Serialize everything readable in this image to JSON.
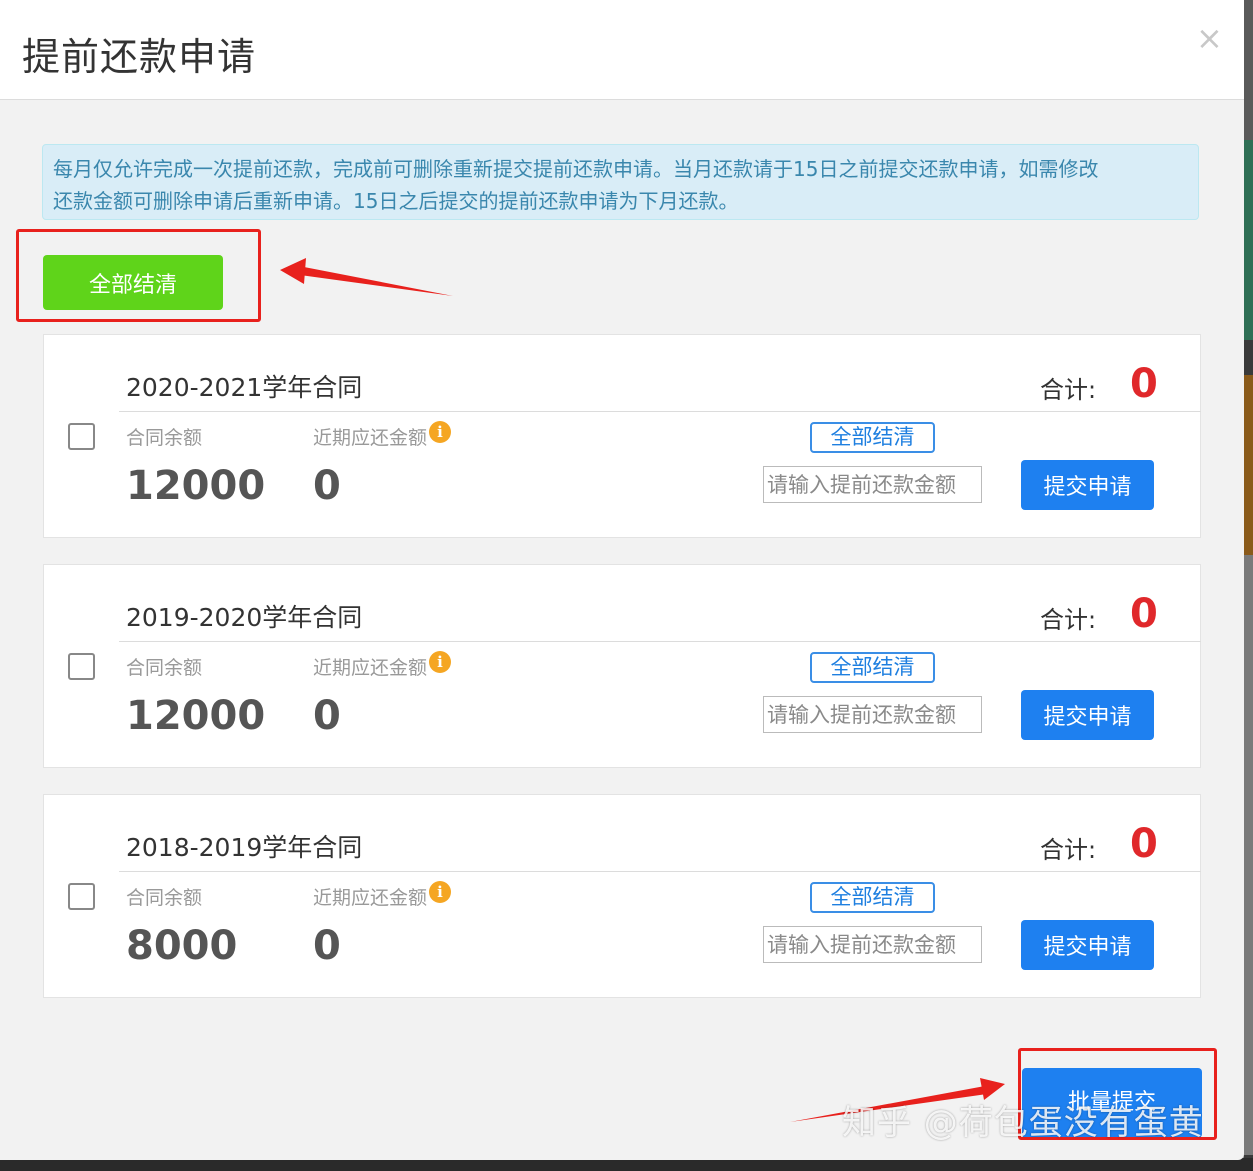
{
  "modal": {
    "title": "提前还款申请",
    "close": "×"
  },
  "notice": {
    "line1": "每月仅允许完成一次提前还款，完成前可删除重新提交提前还款申请。当月还款请于15日之前提交还款申请，如需修改",
    "line2": "还款金额可删除申请后重新申请。15日之后提交的提前还款申请为下月还款。"
  },
  "settle_all_button": "全部结清",
  "contracts": [
    {
      "title": "2020-2021学年合同",
      "total_label": "合计:",
      "total_value": "0",
      "balance_label": "合同余额",
      "balance_value": "12000",
      "due_label": "近期应还金额",
      "due_value": "0",
      "settle_button": "全部结清",
      "input_placeholder": "请输入提前还款金额",
      "submit_button": "提交申请"
    },
    {
      "title": "2019-2020学年合同",
      "total_label": "合计:",
      "total_value": "0",
      "balance_label": "合同余额",
      "balance_value": "12000",
      "due_label": "近期应还金额",
      "due_value": "0",
      "settle_button": "全部结清",
      "input_placeholder": "请输入提前还款金额",
      "submit_button": "提交申请"
    },
    {
      "title": "2018-2019学年合同",
      "total_label": "合计:",
      "total_value": "0",
      "balance_label": "合同余额",
      "balance_value": "8000",
      "due_label": "近期应还金额",
      "due_value": "0",
      "settle_button": "全部结清",
      "input_placeholder": "请输入提前还款金额",
      "submit_button": "提交申请"
    }
  ],
  "batch_submit_button": "批量提交",
  "watermark": "知乎 @荷包蛋没有蛋黄",
  "colors": {
    "green_button": "#5fd41a",
    "blue_button": "#1e80f0",
    "total_red": "#e0282b",
    "annotation_red": "#e8211d",
    "notice_bg": "#d9edf7"
  }
}
